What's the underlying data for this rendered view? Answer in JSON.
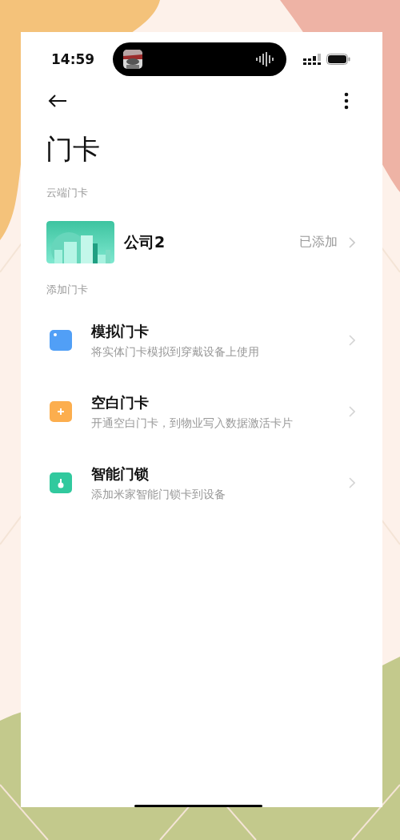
{
  "status_bar": {
    "time": "14:59"
  },
  "title": "门卡",
  "sections": [
    {
      "heading": "云端门卡",
      "items": [
        {
          "kind": "cloud",
          "name": "公司2",
          "status": "已添加"
        }
      ]
    },
    {
      "heading": "添加门卡",
      "items": [
        {
          "kind": "option",
          "name": "模拟门卡",
          "description": "将实体门卡模拟到穿戴设备上使用",
          "color": "#519ff6"
        },
        {
          "kind": "option",
          "name": "空白门卡",
          "description": "开通空白门卡，到物业写入数据激活卡片",
          "color": "#fcae4e"
        },
        {
          "kind": "option",
          "name": "智能门锁",
          "description": "添加米家智能门锁卡到设备",
          "color": "#31c99e"
        }
      ]
    }
  ]
}
